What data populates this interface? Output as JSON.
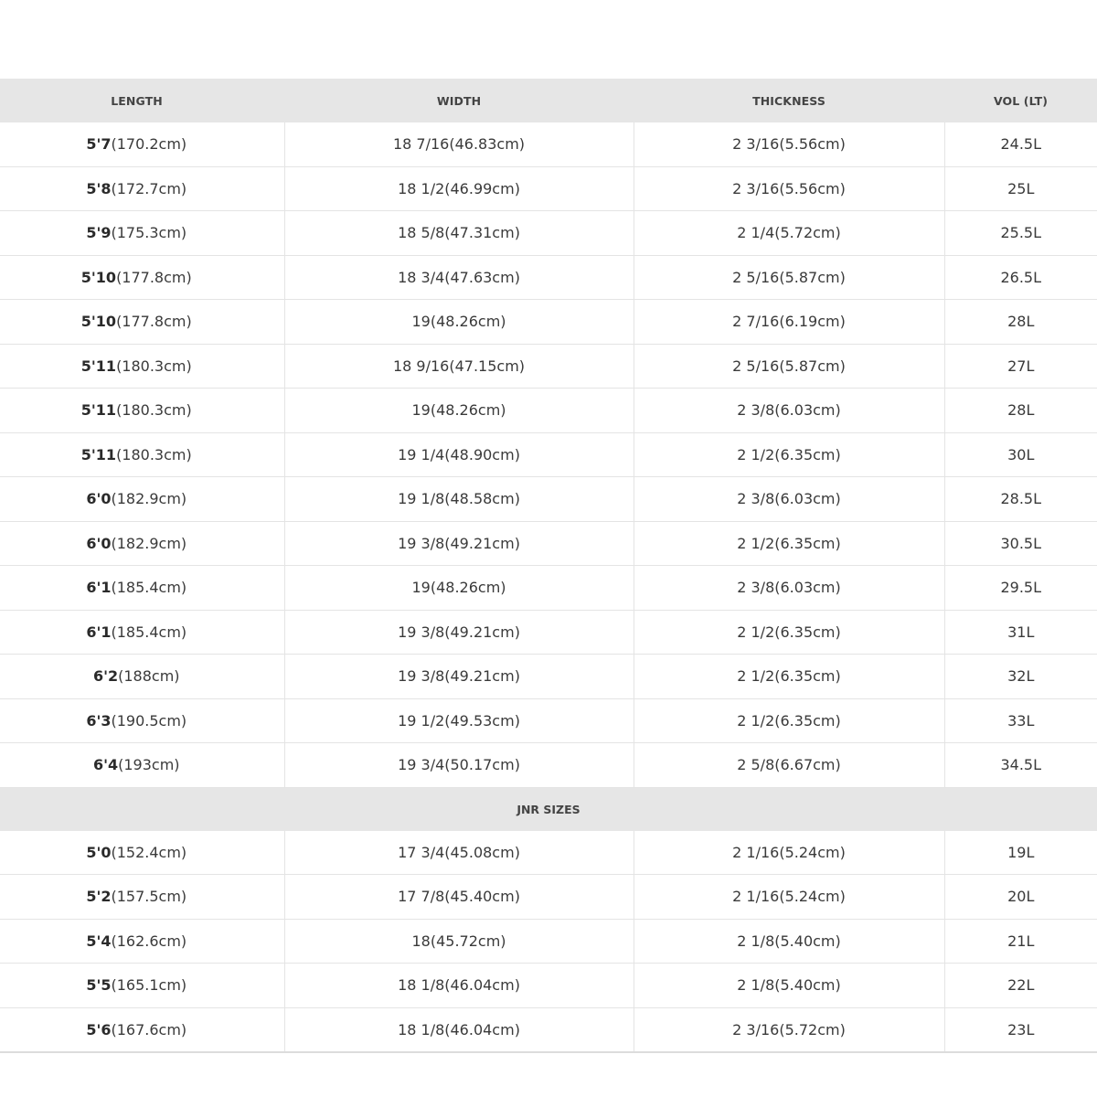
{
  "table": {
    "headers": [
      "LENGTH",
      "WIDTH",
      "THICKNESS",
      "VOL (LT)"
    ],
    "rows": [
      {
        "feet": "5'7",
        "cm": "(170.2cm)",
        "width": "18 7/16(46.83cm)",
        "thickness": "2 3/16(5.56cm)",
        "volume": "24.5L"
      },
      {
        "feet": "5'8",
        "cm": "(172.7cm)",
        "width": "18 1/2(46.99cm)",
        "thickness": "2 3/16(5.56cm)",
        "volume": "25L"
      },
      {
        "feet": "5'9",
        "cm": "(175.3cm)",
        "width": "18 5/8(47.31cm)",
        "thickness": "2 1/4(5.72cm)",
        "volume": "25.5L"
      },
      {
        "feet": "5'10",
        "cm": "(177.8cm)",
        "width": "18 3/4(47.63cm)",
        "thickness": "2 5/16(5.87cm)",
        "volume": "26.5L"
      },
      {
        "feet": "5'10",
        "cm": "(177.8cm)",
        "width": "19(48.26cm)",
        "thickness": "2 7/16(6.19cm)",
        "volume": "28L"
      },
      {
        "feet": "5'11",
        "cm": "(180.3cm)",
        "width": "18 9/16(47.15cm)",
        "thickness": "2 5/16(5.87cm)",
        "volume": "27L"
      },
      {
        "feet": "5'11",
        "cm": "(180.3cm)",
        "width": "19(48.26cm)",
        "thickness": "2 3/8(6.03cm)",
        "volume": "28L"
      },
      {
        "feet": "5'11",
        "cm": "(180.3cm)",
        "width": "19 1/4(48.90cm)",
        "thickness": "2 1/2(6.35cm)",
        "volume": "30L"
      },
      {
        "feet": "6'0",
        "cm": "(182.9cm)",
        "width": "19 1/8(48.58cm)",
        "thickness": "2 3/8(6.03cm)",
        "volume": "28.5L"
      },
      {
        "feet": "6'0",
        "cm": "(182.9cm)",
        "width": "19 3/8(49.21cm)",
        "thickness": "2 1/2(6.35cm)",
        "volume": "30.5L"
      },
      {
        "feet": "6'1",
        "cm": "(185.4cm)",
        "width": "19(48.26cm)",
        "thickness": "2 3/8(6.03cm)",
        "volume": "29.5L"
      },
      {
        "feet": "6'1",
        "cm": "(185.4cm)",
        "width": "19 3/8(49.21cm)",
        "thickness": "2 1/2(6.35cm)",
        "volume": "31L"
      },
      {
        "feet": "6'2",
        "cm": "(188cm)",
        "width": "19 3/8(49.21cm)",
        "thickness": "2 1/2(6.35cm)",
        "volume": "32L"
      },
      {
        "feet": "6'3",
        "cm": "(190.5cm)",
        "width": "19 1/2(49.53cm)",
        "thickness": "2 1/2(6.35cm)",
        "volume": "33L"
      },
      {
        "feet": "6'4",
        "cm": "(193cm)",
        "width": "19 3/4(50.17cm)",
        "thickness": "2 5/8(6.67cm)",
        "volume": "34.5L"
      }
    ],
    "junior_label": "JNR SIZES",
    "junior_rows": [
      {
        "feet": "5'0",
        "cm": "(152.4cm)",
        "width": "17 3/4(45.08cm)",
        "thickness": "2 1/16(5.24cm)",
        "volume": "19L"
      },
      {
        "feet": "5'2",
        "cm": "(157.5cm)",
        "width": "17 7/8(45.40cm)",
        "thickness": "2 1/16(5.24cm)",
        "volume": "20L"
      },
      {
        "feet": "5'4",
        "cm": "(162.6cm)",
        "width": "18(45.72cm)",
        "thickness": "2 1/8(5.40cm)",
        "volume": "21L"
      },
      {
        "feet": "5'5",
        "cm": "(165.1cm)",
        "width": "18 1/8(46.04cm)",
        "thickness": "2 1/8(5.40cm)",
        "volume": "22L"
      },
      {
        "feet": "5'6",
        "cm": "(167.6cm)",
        "width": "18 1/8(46.04cm)",
        "thickness": "2 3/16(5.72cm)",
        "volume": "23L"
      }
    ]
  }
}
